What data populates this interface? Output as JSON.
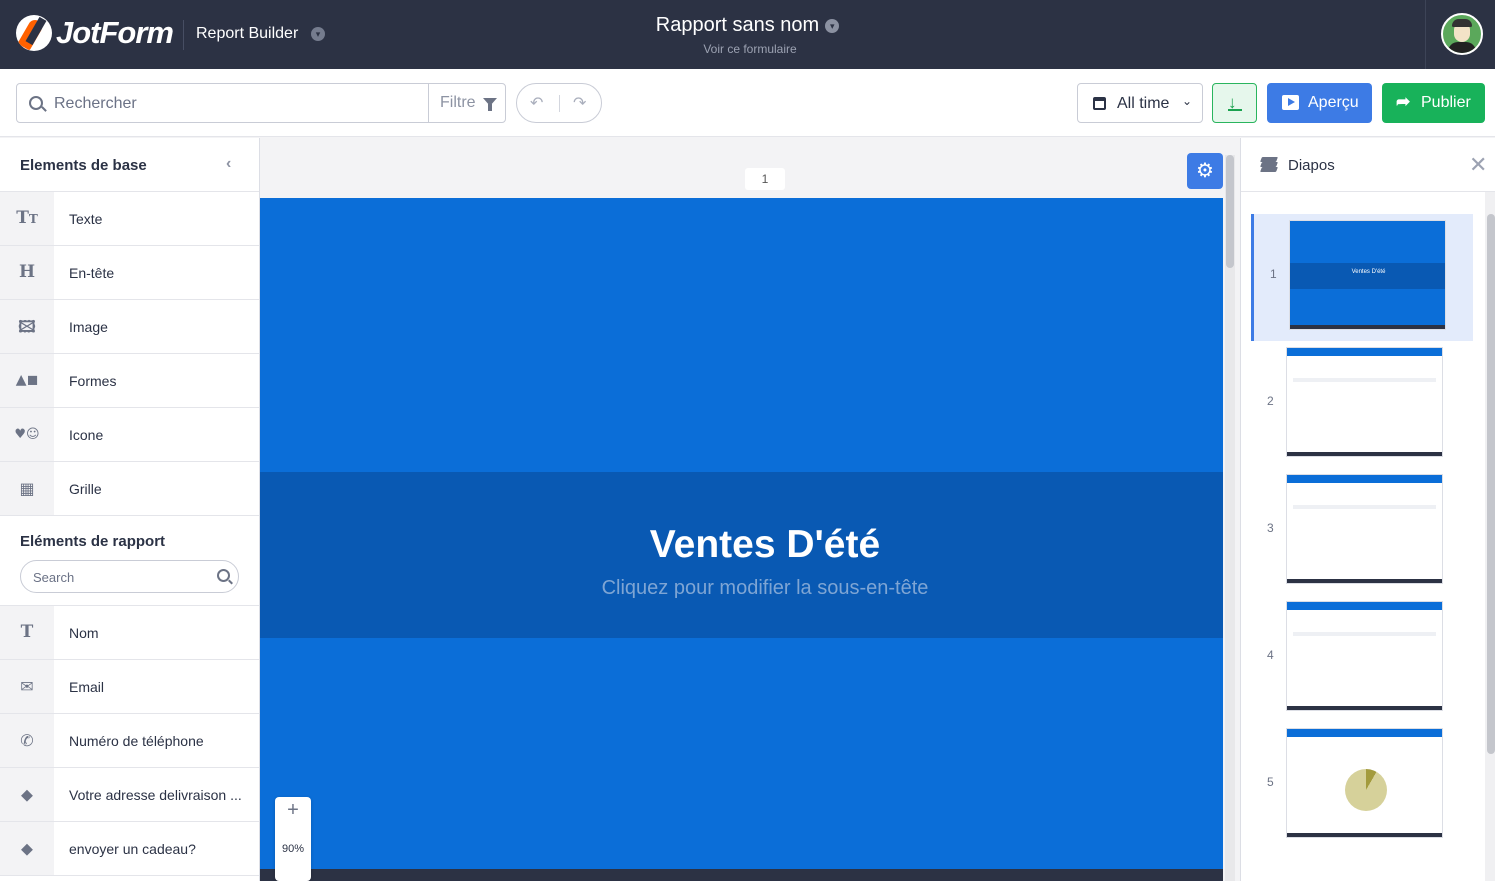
{
  "app": {
    "brand": "JotForm",
    "product": "Report Builder",
    "report_title": "Rapport sans nom",
    "report_subtitle": "Voir ce formulaire"
  },
  "toolbar": {
    "search_placeholder": "Rechercher",
    "filter_label": "Filtre",
    "range_label": "All time",
    "preview_label": "Aperçu",
    "publish_label": "Publier"
  },
  "left_panel": {
    "basic_title": "Elements de base",
    "basic_items": [
      {
        "label": "Texte",
        "icon": "text-icon"
      },
      {
        "label": "En-tête",
        "icon": "heading-icon"
      },
      {
        "label": "Image",
        "icon": "image-icon"
      },
      {
        "label": "Formes",
        "icon": "shapes-icon"
      },
      {
        "label": "Icone",
        "icon": "icon-set-icon"
      },
      {
        "label": "Grille",
        "icon": "grid-icon"
      }
    ],
    "report_title": "Eléments de rapport",
    "report_search_placeholder": "Search",
    "report_items": [
      {
        "label": "Nom",
        "icon": "text-field-icon"
      },
      {
        "label": "Email",
        "icon": "envelope-icon"
      },
      {
        "label": "Numéro de téléphone",
        "icon": "phone-icon"
      },
      {
        "label": "Votre adresse delivraison ...",
        "icon": "tag-icon"
      },
      {
        "label": "envoyer un cadeau?",
        "icon": "tag-icon"
      }
    ]
  },
  "canvas": {
    "page_number": "1",
    "slide_title": "Ventes D'été",
    "slide_subtitle": "Cliquez pour modifier la sous-en-tête",
    "zoom_level": "90%"
  },
  "right_panel": {
    "title": "Diapos",
    "slides": [
      {
        "number": "1",
        "title": "Ventes D'été"
      },
      {
        "number": "2"
      },
      {
        "number": "3"
      },
      {
        "number": "4"
      },
      {
        "number": "5"
      }
    ],
    "active_slide": 1
  },
  "colors": {
    "topbar": "#2c3244",
    "slide_blue": "#0b6ed8",
    "band_blue": "#0959b3",
    "preview": "#3d7be5",
    "publish": "#18b25a"
  }
}
